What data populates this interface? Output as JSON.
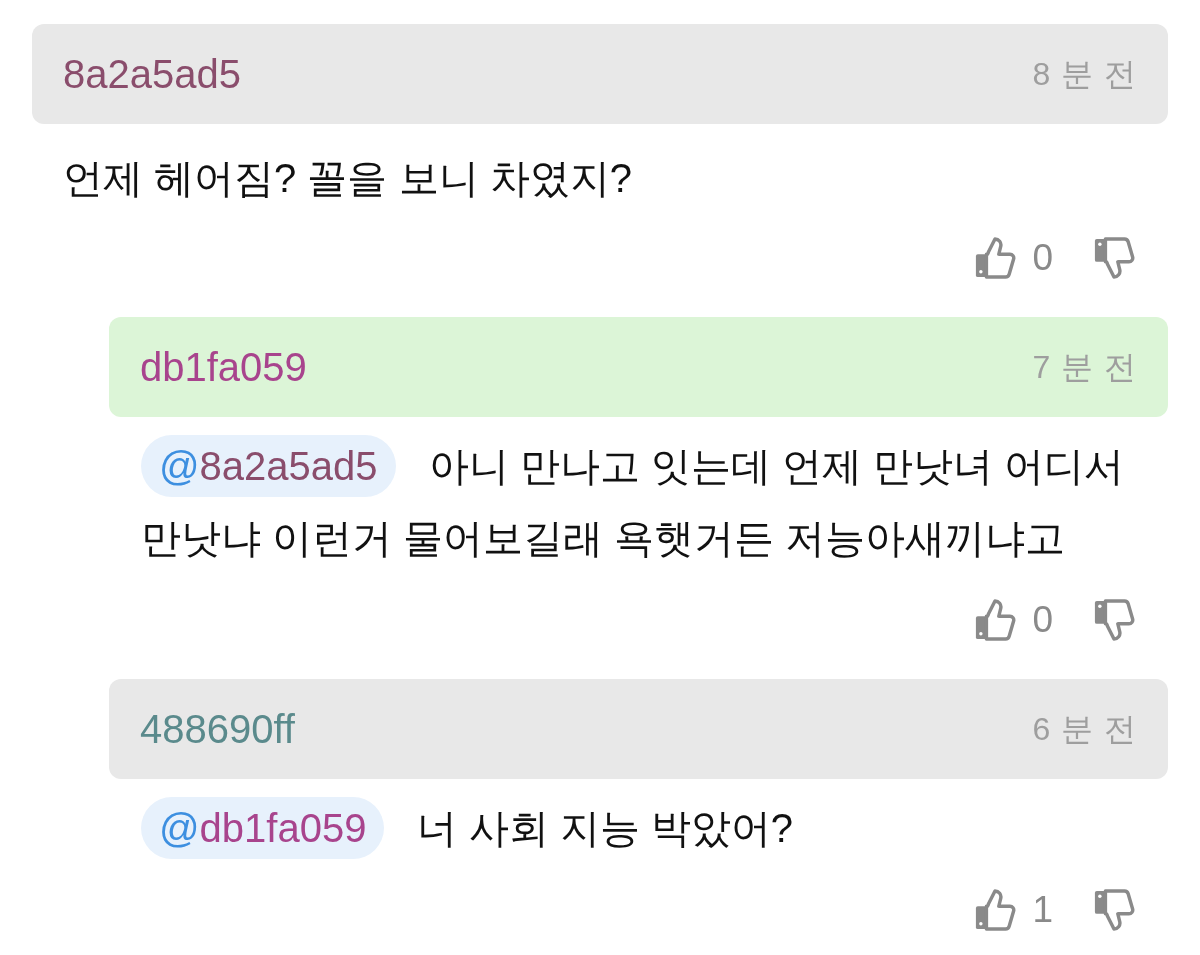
{
  "comments": [
    {
      "author": "8a2a5ad5",
      "color": "#8a4d6c",
      "highlighted": false,
      "time": "8 분 전",
      "lines": [
        "언제 헤어짐? 꼴을 보니 차였지?"
      ],
      "likes": "0",
      "children": [
        {
          "author": "db1fa059",
          "color": "#a8448d",
          "highlighted": true,
          "time": "7 분 전",
          "mention": {
            "symbol": "@",
            "name": "8a2a5ad5",
            "color": "#8a4d6c"
          },
          "lines": [
            "아니 만나고 잇는데 언제 만낫녀 어디서",
            "만낫냐 이런거 물어보길래 욕햇거든 저능아새끼냐고"
          ],
          "likes": "0"
        },
        {
          "author": "488690ff",
          "color": "#5a8a8c",
          "highlighted": false,
          "time": "6 분 전",
          "mention": {
            "symbol": "@",
            "name": "db1fa059",
            "color": "#a8448d"
          },
          "lines": [
            "너 사회 지능 박았어?"
          ],
          "likes": "1"
        }
      ]
    }
  ]
}
